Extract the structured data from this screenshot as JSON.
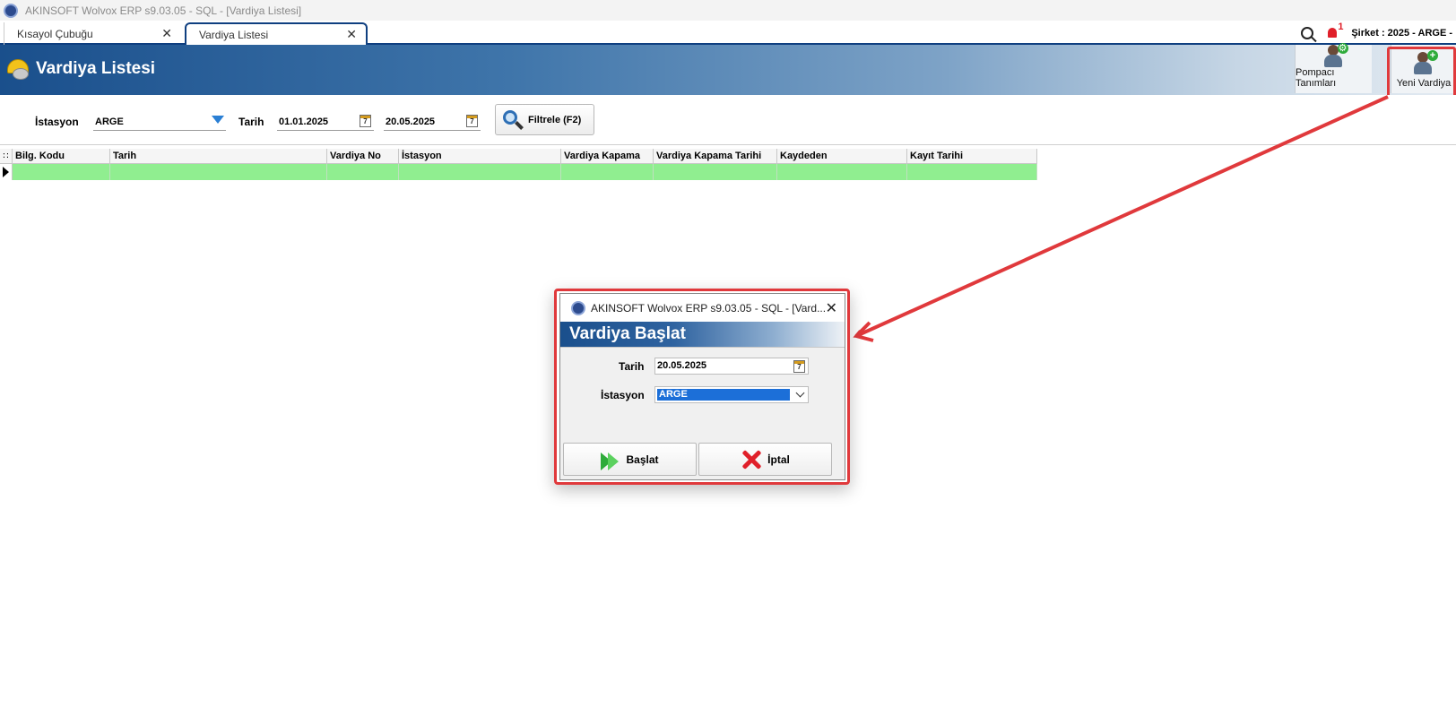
{
  "window": {
    "title": "AKINSOFT Wolvox ERP s9.03.05 - SQL - [Vardiya Listesi]"
  },
  "tabs": [
    {
      "label": "Kısayol Çubuğu",
      "close": "✕"
    },
    {
      "label": "Vardiya Listesi",
      "close": "✕"
    }
  ],
  "topright": {
    "notification_count": "1",
    "company": "Şirket : 2025 - ARGE -"
  },
  "header": {
    "title": "Vardiya Listesi",
    "buttons": {
      "pompaci": "Pompacı Tanımları",
      "yeni": "Yeni Vardiya"
    }
  },
  "filter": {
    "istasyon_label": "İstasyon",
    "istasyon_value": "ARGE",
    "tarih_label": "Tarih",
    "date_from": "01.01.2025",
    "date_to": "20.05.2025",
    "cal_glyph": "7",
    "filter_button": "Filtrele (F2)"
  },
  "grid": {
    "columns": [
      "Bilg. Kodu",
      "Tarih",
      "Vardiya No",
      "İstasyon",
      "Vardiya Kapama",
      "Vardiya Kapama Tarihi",
      "Kaydeden",
      "Kayıt Tarihi"
    ],
    "indicator_header": "∷"
  },
  "dialog": {
    "title": "AKINSOFT Wolvox ERP s9.03.05 - SQL - [Vard...",
    "band_title": "Vardiya Başlat",
    "tarih_label": "Tarih",
    "tarih_value": "20.05.2025",
    "istasyon_label": "İstasyon",
    "istasyon_value": "ARGE",
    "start_button": "Başlat",
    "cancel_button": "İptal",
    "close": "✕"
  },
  "colors": {
    "accent": "#1a4f8c",
    "annotation": "#e0393c",
    "row_highlight": "#90ee90"
  }
}
